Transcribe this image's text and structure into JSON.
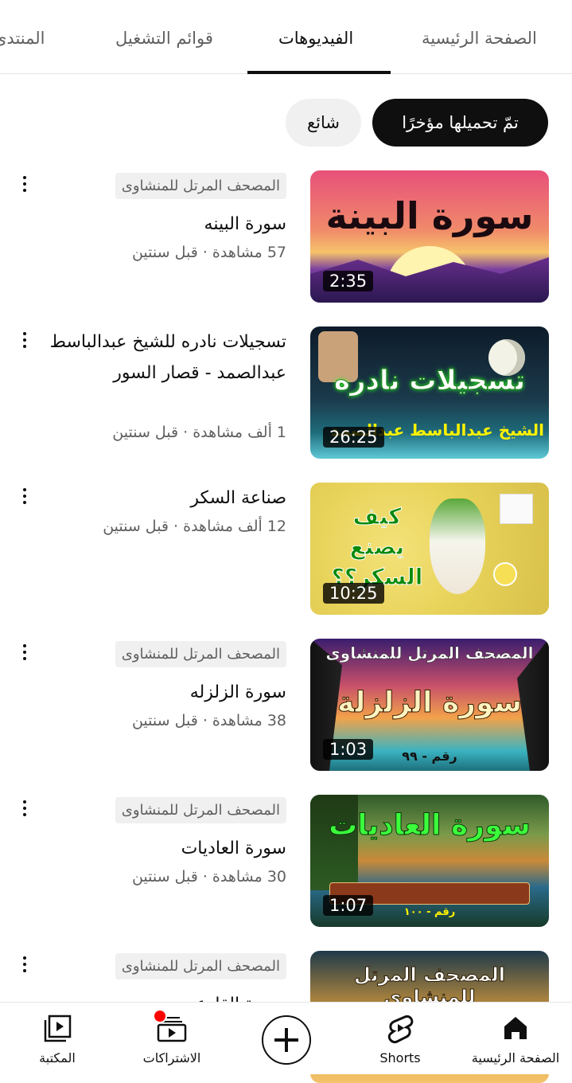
{
  "tabs": [
    {
      "label": "الصفحة الرئيسية",
      "active": false
    },
    {
      "label": "الفيديوهات",
      "active": true
    },
    {
      "label": "قوائم التشغيل",
      "active": false
    },
    {
      "label": "المنتدى",
      "active": false
    }
  ],
  "chips": {
    "recent": "تمّ تحميلها مؤخرًا",
    "popular": "شائع"
  },
  "videos": [
    {
      "playlist": "المصحف المرتل للمنشاوى",
      "title": "سورة البينه",
      "views": "57 مشاهدة",
      "age": "قبل سنتين",
      "meta": "57 مشاهدة · قبل سنتين",
      "duration": "2:35",
      "thumb_text": "سورة البينة"
    },
    {
      "playlist": "",
      "title": "تسجيلات نادره للشيخ عبدالباسط عبدالصمد - قصار السور",
      "views": "1 ألف مشاهدة",
      "age": "قبل سنتين",
      "meta": "1 ألف مشاهدة · قبل سنتين",
      "duration": "26:25",
      "thumb_text": "تسجيلات نادره",
      "thumb_subtext": "الشيخ عبدالباسط عبدالصمد"
    },
    {
      "playlist": "",
      "title": "صناعة السكر",
      "views": "12 ألف مشاهدة",
      "age": "قبل سنتين",
      "meta": "12 ألف مشاهدة · قبل سنتين",
      "duration": "10:25",
      "thumb_text": "كيف يصنع السكر؟؟"
    },
    {
      "playlist": "المصحف المرتل للمنشاوى",
      "title": "سورة الزلزله",
      "views": "38 مشاهدة",
      "age": "قبل سنتين",
      "meta": "38 مشاهدة · قبل سنتين",
      "duration": "1:03",
      "thumb_header": "المصحف المرتل للمنشاوى",
      "thumb_text": "سورة الزلزلة",
      "thumb_subtext": "رقم - ٩٩"
    },
    {
      "playlist": "المصحف المرتل للمنشاوى",
      "title": "سورة العاديات",
      "views": "30 مشاهدة",
      "age": "قبل سنتين",
      "meta": "30 مشاهدة · قبل سنتين",
      "duration": "1:07",
      "thumb_text": "سورة العاديات",
      "thumb_subtext": "رقم - ١٠٠"
    },
    {
      "playlist": "المصحف المرتل للمنشاوى",
      "title": "سورة القارعه",
      "thumb_header": "المصحف المرتل للمنشاوى"
    }
  ],
  "bottom_nav": [
    {
      "label": "الصفحة الرئيسية",
      "icon": "home-icon"
    },
    {
      "label": "Shorts",
      "icon": "shorts-icon"
    },
    {
      "label": "",
      "icon": "create-icon"
    },
    {
      "label": "الاشتراكات",
      "icon": "subscriptions-icon"
    },
    {
      "label": "المكتبة",
      "icon": "library-icon"
    }
  ],
  "colors": {
    "accent_dark": "#0f0f0f",
    "chip_bg": "#f0f0f0",
    "secondary_text": "#606060",
    "notification_dot": "#ff0000"
  }
}
